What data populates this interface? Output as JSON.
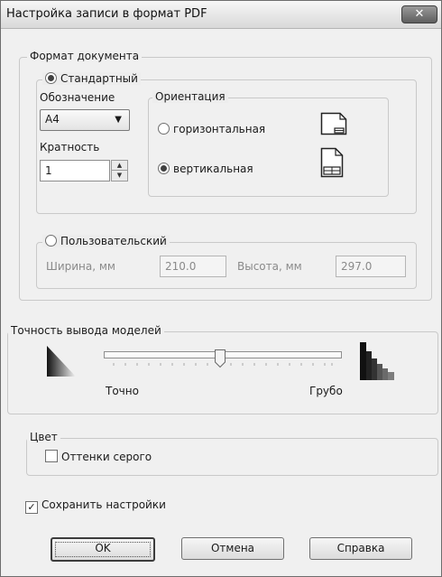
{
  "window": {
    "title": "Настройка записи в формат PDF",
    "close_label": "✕"
  },
  "format": {
    "legend": "Формат документа",
    "standard": {
      "label": "Стандартный",
      "designation_label": "Обозначение",
      "designation_value": "А4",
      "multiplicity_label": "Кратность",
      "multiplicity_value": "1"
    },
    "orientation": {
      "legend": "Ориентация",
      "landscape_label": "горизонтальная",
      "portrait_label": "вертикальная",
      "selected": "portrait"
    },
    "custom": {
      "label": "Пользовательский",
      "width_label": "Ширина, мм",
      "width_value": "210.0",
      "height_label": "Высота, мм",
      "height_value": "297.0"
    }
  },
  "precision": {
    "legend": "Точность вывода моделей",
    "min_label": "Точно",
    "max_label": "Грубо",
    "slider_value": 0.5
  },
  "color": {
    "legend": "Цвет",
    "grayscale_label": "Оттенки серого",
    "grayscale_checked": false
  },
  "save_settings": {
    "label": "Сохранить настройки",
    "checked": true
  },
  "buttons": {
    "ok": "OK",
    "cancel": "Отмена",
    "help": "Справка"
  }
}
